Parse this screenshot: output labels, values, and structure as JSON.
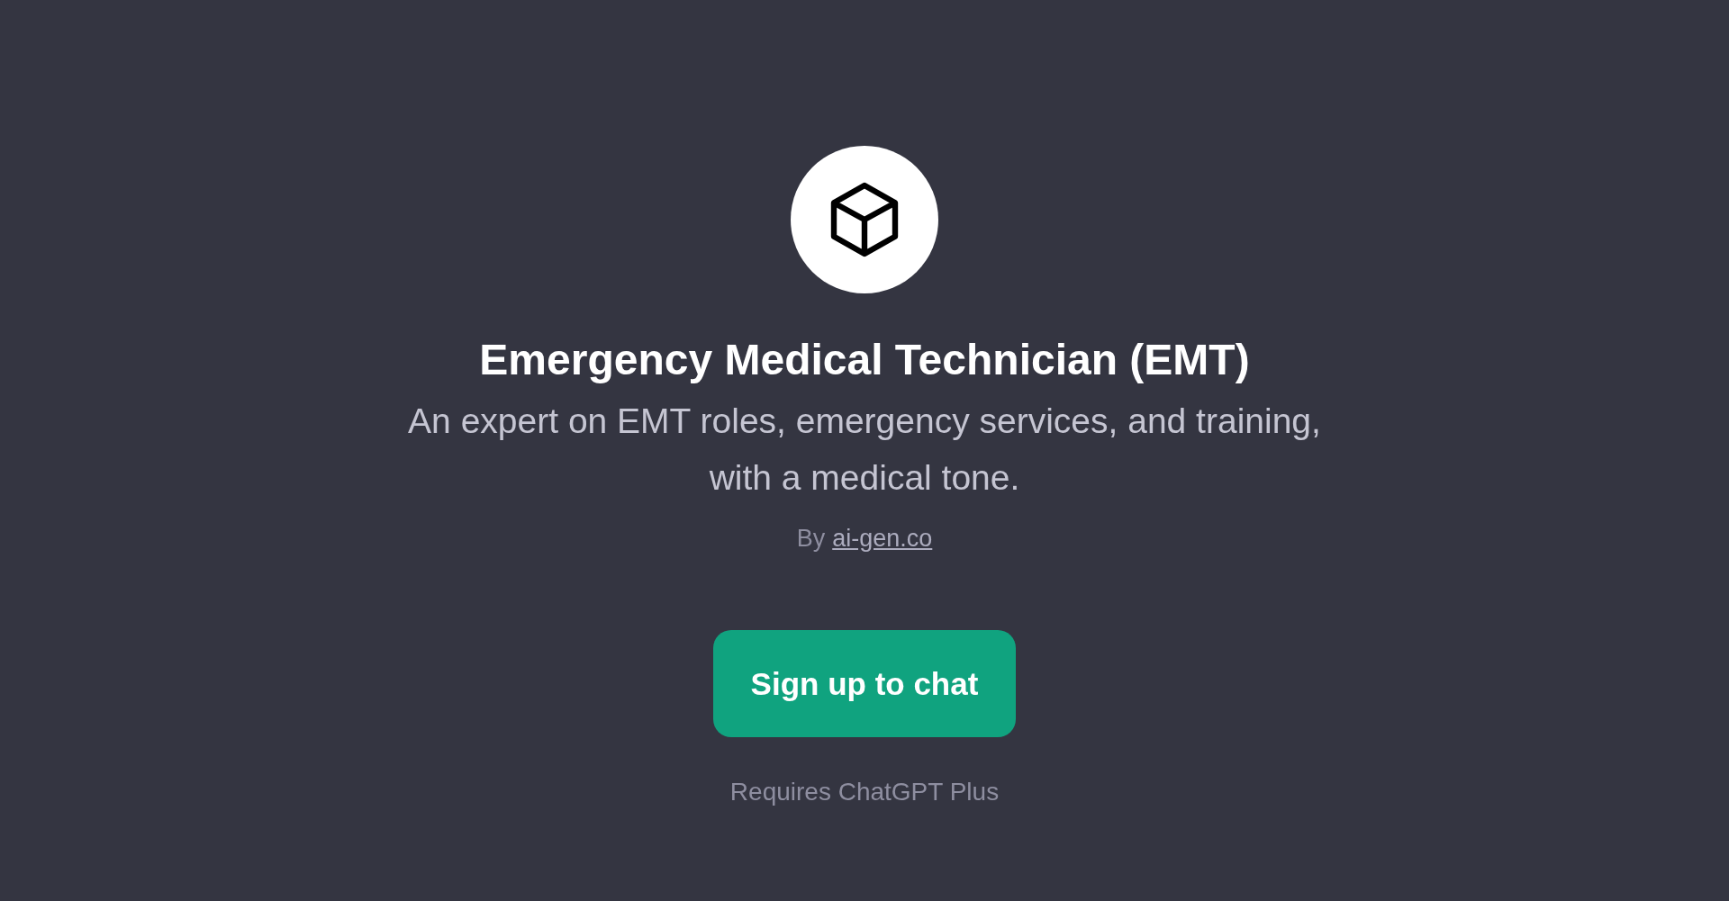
{
  "title": "Emergency Medical Technician (EMT)",
  "description": "An expert on EMT roles, emergency services, and training, with a medical tone.",
  "author": {
    "prefix": "By",
    "link": "ai-gen.co"
  },
  "button": "Sign up to chat",
  "note": "Requires ChatGPT Plus"
}
